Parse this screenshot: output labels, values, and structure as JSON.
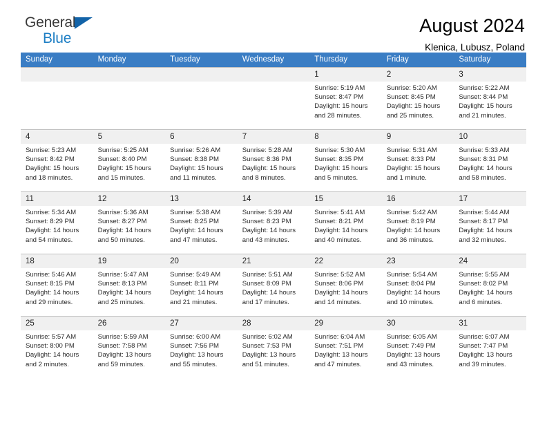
{
  "brand": {
    "name_part1": "General",
    "name_part2": "Blue",
    "flag_icon": "triangle-flag-icon"
  },
  "header": {
    "title": "August 2024",
    "subtitle": "Klenica, Lubusz, Poland"
  },
  "calendar": {
    "weekday_headers": [
      "Sunday",
      "Monday",
      "Tuesday",
      "Wednesday",
      "Thursday",
      "Friday",
      "Saturday"
    ],
    "accent_color": "#3a7dc4",
    "daynum_bg": "#f0f0f0",
    "grid_line_color": "#bfbfbf",
    "weeks": [
      [
        {
          "day": "",
          "lines": []
        },
        {
          "day": "",
          "lines": []
        },
        {
          "day": "",
          "lines": []
        },
        {
          "day": "",
          "lines": []
        },
        {
          "day": "1",
          "lines": [
            "Sunrise: 5:19 AM",
            "Sunset: 8:47 PM",
            "Daylight: 15 hours",
            "and 28 minutes."
          ]
        },
        {
          "day": "2",
          "lines": [
            "Sunrise: 5:20 AM",
            "Sunset: 8:45 PM",
            "Daylight: 15 hours",
            "and 25 minutes."
          ]
        },
        {
          "day": "3",
          "lines": [
            "Sunrise: 5:22 AM",
            "Sunset: 8:44 PM",
            "Daylight: 15 hours",
            "and 21 minutes."
          ]
        }
      ],
      [
        {
          "day": "4",
          "lines": [
            "Sunrise: 5:23 AM",
            "Sunset: 8:42 PM",
            "Daylight: 15 hours",
            "and 18 minutes."
          ]
        },
        {
          "day": "5",
          "lines": [
            "Sunrise: 5:25 AM",
            "Sunset: 8:40 PM",
            "Daylight: 15 hours",
            "and 15 minutes."
          ]
        },
        {
          "day": "6",
          "lines": [
            "Sunrise: 5:26 AM",
            "Sunset: 8:38 PM",
            "Daylight: 15 hours",
            "and 11 minutes."
          ]
        },
        {
          "day": "7",
          "lines": [
            "Sunrise: 5:28 AM",
            "Sunset: 8:36 PM",
            "Daylight: 15 hours",
            "and 8 minutes."
          ]
        },
        {
          "day": "8",
          "lines": [
            "Sunrise: 5:30 AM",
            "Sunset: 8:35 PM",
            "Daylight: 15 hours",
            "and 5 minutes."
          ]
        },
        {
          "day": "9",
          "lines": [
            "Sunrise: 5:31 AM",
            "Sunset: 8:33 PM",
            "Daylight: 15 hours",
            "and 1 minute."
          ]
        },
        {
          "day": "10",
          "lines": [
            "Sunrise: 5:33 AM",
            "Sunset: 8:31 PM",
            "Daylight: 14 hours",
            "and 58 minutes."
          ]
        }
      ],
      [
        {
          "day": "11",
          "lines": [
            "Sunrise: 5:34 AM",
            "Sunset: 8:29 PM",
            "Daylight: 14 hours",
            "and 54 minutes."
          ]
        },
        {
          "day": "12",
          "lines": [
            "Sunrise: 5:36 AM",
            "Sunset: 8:27 PM",
            "Daylight: 14 hours",
            "and 50 minutes."
          ]
        },
        {
          "day": "13",
          "lines": [
            "Sunrise: 5:38 AM",
            "Sunset: 8:25 PM",
            "Daylight: 14 hours",
            "and 47 minutes."
          ]
        },
        {
          "day": "14",
          "lines": [
            "Sunrise: 5:39 AM",
            "Sunset: 8:23 PM",
            "Daylight: 14 hours",
            "and 43 minutes."
          ]
        },
        {
          "day": "15",
          "lines": [
            "Sunrise: 5:41 AM",
            "Sunset: 8:21 PM",
            "Daylight: 14 hours",
            "and 40 minutes."
          ]
        },
        {
          "day": "16",
          "lines": [
            "Sunrise: 5:42 AM",
            "Sunset: 8:19 PM",
            "Daylight: 14 hours",
            "and 36 minutes."
          ]
        },
        {
          "day": "17",
          "lines": [
            "Sunrise: 5:44 AM",
            "Sunset: 8:17 PM",
            "Daylight: 14 hours",
            "and 32 minutes."
          ]
        }
      ],
      [
        {
          "day": "18",
          "lines": [
            "Sunrise: 5:46 AM",
            "Sunset: 8:15 PM",
            "Daylight: 14 hours",
            "and 29 minutes."
          ]
        },
        {
          "day": "19",
          "lines": [
            "Sunrise: 5:47 AM",
            "Sunset: 8:13 PM",
            "Daylight: 14 hours",
            "and 25 minutes."
          ]
        },
        {
          "day": "20",
          "lines": [
            "Sunrise: 5:49 AM",
            "Sunset: 8:11 PM",
            "Daylight: 14 hours",
            "and 21 minutes."
          ]
        },
        {
          "day": "21",
          "lines": [
            "Sunrise: 5:51 AM",
            "Sunset: 8:09 PM",
            "Daylight: 14 hours",
            "and 17 minutes."
          ]
        },
        {
          "day": "22",
          "lines": [
            "Sunrise: 5:52 AM",
            "Sunset: 8:06 PM",
            "Daylight: 14 hours",
            "and 14 minutes."
          ]
        },
        {
          "day": "23",
          "lines": [
            "Sunrise: 5:54 AM",
            "Sunset: 8:04 PM",
            "Daylight: 14 hours",
            "and 10 minutes."
          ]
        },
        {
          "day": "24",
          "lines": [
            "Sunrise: 5:55 AM",
            "Sunset: 8:02 PM",
            "Daylight: 14 hours",
            "and 6 minutes."
          ]
        }
      ],
      [
        {
          "day": "25",
          "lines": [
            "Sunrise: 5:57 AM",
            "Sunset: 8:00 PM",
            "Daylight: 14 hours",
            "and 2 minutes."
          ]
        },
        {
          "day": "26",
          "lines": [
            "Sunrise: 5:59 AM",
            "Sunset: 7:58 PM",
            "Daylight: 13 hours",
            "and 59 minutes."
          ]
        },
        {
          "day": "27",
          "lines": [
            "Sunrise: 6:00 AM",
            "Sunset: 7:56 PM",
            "Daylight: 13 hours",
            "and 55 minutes."
          ]
        },
        {
          "day": "28",
          "lines": [
            "Sunrise: 6:02 AM",
            "Sunset: 7:53 PM",
            "Daylight: 13 hours",
            "and 51 minutes."
          ]
        },
        {
          "day": "29",
          "lines": [
            "Sunrise: 6:04 AM",
            "Sunset: 7:51 PM",
            "Daylight: 13 hours",
            "and 47 minutes."
          ]
        },
        {
          "day": "30",
          "lines": [
            "Sunrise: 6:05 AM",
            "Sunset: 7:49 PM",
            "Daylight: 13 hours",
            "and 43 minutes."
          ]
        },
        {
          "day": "31",
          "lines": [
            "Sunrise: 6:07 AM",
            "Sunset: 7:47 PM",
            "Daylight: 13 hours",
            "and 39 minutes."
          ]
        }
      ]
    ]
  }
}
